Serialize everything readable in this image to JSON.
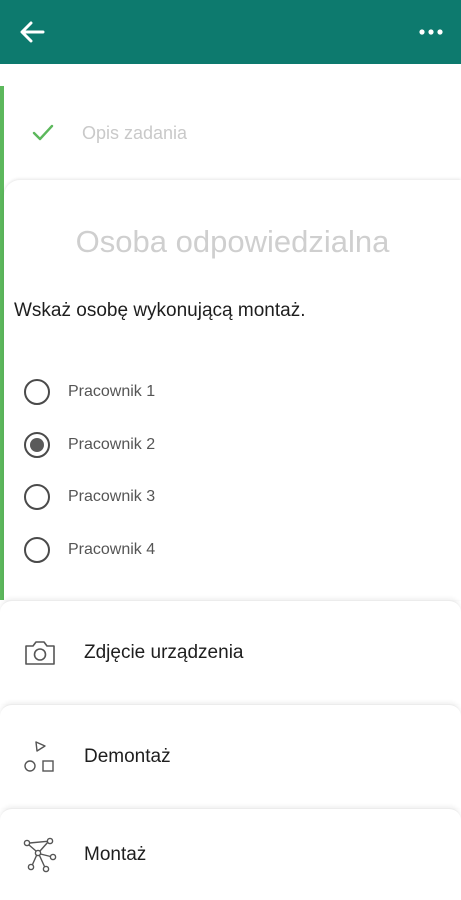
{
  "header": {
    "back_icon": "arrow-left-icon",
    "menu_icon": "more-horizontal-icon",
    "background": "#0d7a6e"
  },
  "steps": {
    "completed": {
      "icon": "check-icon",
      "label": "Opis zadania"
    },
    "active": {
      "title": "Osoba odpowiedzialna",
      "question": "Wskaż osobę wykonującą montaż.",
      "options": [
        "Pracownik 1",
        "Pracownik 2",
        "Pracownik 3",
        "Pracownik 4"
      ],
      "selected": "Pracownik 2"
    },
    "upcoming": [
      {
        "icon": "camera-icon",
        "label": "Zdjęcie urządzenia"
      },
      {
        "icon": "shapes-icon",
        "label": "Demontaż"
      },
      {
        "icon": "network-icon",
        "label": "Montaż"
      }
    ]
  },
  "colors": {
    "accent_green": "#5cb85c",
    "primary_teal": "#0d7a6e"
  }
}
